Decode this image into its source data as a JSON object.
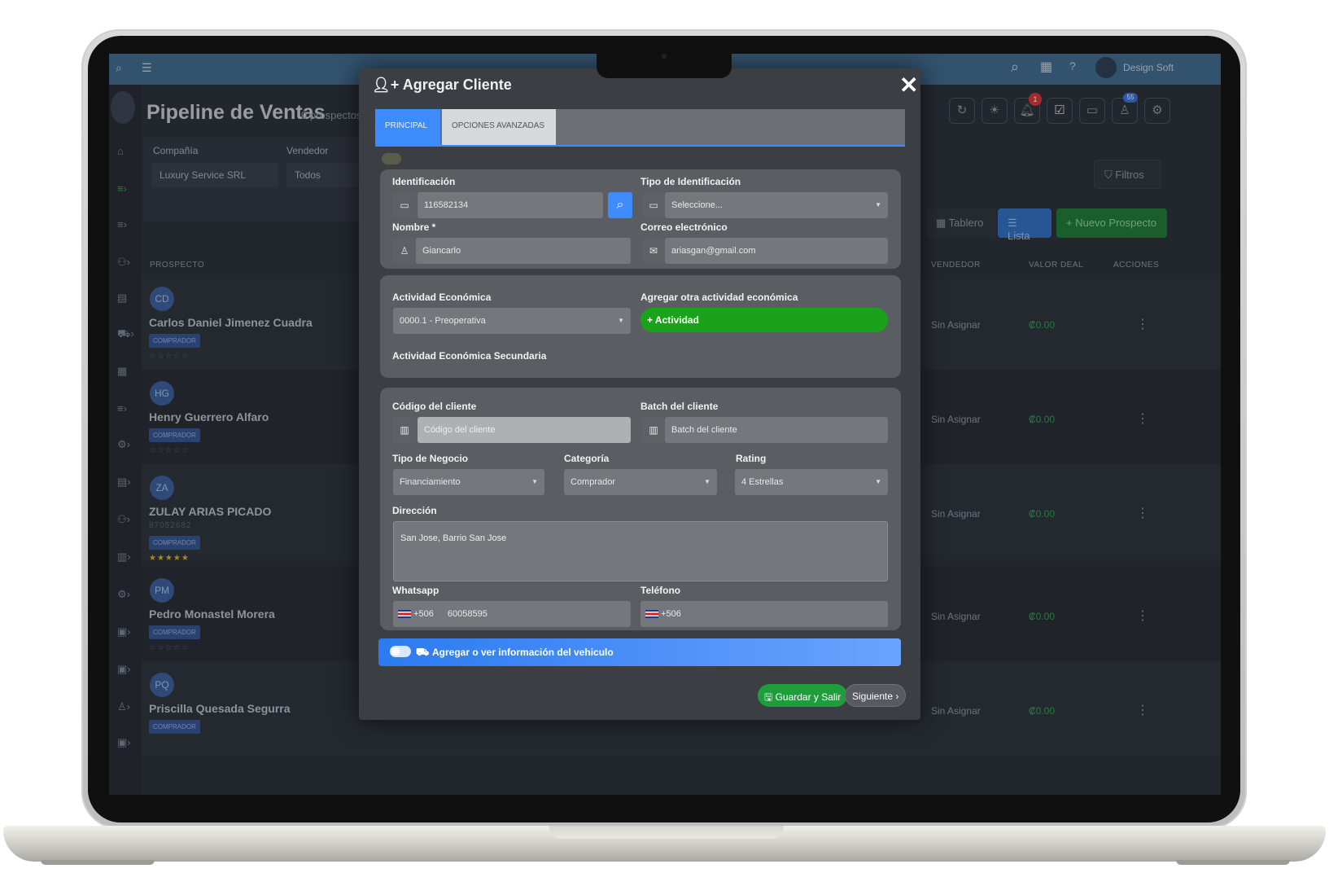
{
  "topbar": {
    "brand": "Design Soft"
  },
  "page": {
    "title": "Pipeline de Ventas",
    "subtitle": "0 prospectos ac"
  },
  "filters": {
    "company_label": "Compañía",
    "company_value": "Luxury Service SRL",
    "seller_label": "Vendedor",
    "seller_value": "Todos",
    "filters_button": "Filtros"
  },
  "view_buttons": {
    "board": "Tablero",
    "list": "Lista",
    "new": "+ Nuevo Prospecto"
  },
  "notifications": {
    "bell_count": "1",
    "users_count": "55"
  },
  "table": {
    "headers": {
      "prospect": "PROSPECTO",
      "seller": "VENDEDOR",
      "deal_value": "VALOR DEAL",
      "actions": "ACCIONES"
    },
    "rows": [
      {
        "initials": "CD",
        "name": "Carlos Daniel Jimenez Cuadra",
        "badge": "COMPRADOR",
        "phone": "",
        "stars": "☆☆☆☆☆",
        "seller": "Sin Asignar",
        "value": "₡0.00"
      },
      {
        "initials": "HG",
        "name": "Henry Guerrero Alfaro",
        "badge": "COMPRADOR",
        "phone": "",
        "stars": "☆☆☆☆☆",
        "seller": "Sin Asignar",
        "value": "₡0.00"
      },
      {
        "initials": "ZA",
        "name": "ZULAY ARIAS PICADO",
        "badge": "COMPRADOR",
        "phone": "87052682",
        "stars": "★★★★★",
        "seller": "Sin Asignar",
        "value": "₡0.00"
      },
      {
        "initials": "PM",
        "name": "Pedro Monastel Morera",
        "badge": "COMPRADOR",
        "phone": "",
        "stars": "☆☆☆☆☆",
        "seller": "Sin Asignar",
        "value": "₡0.00"
      },
      {
        "initials": "PQ",
        "name": "Priscilla Quesada Segurra",
        "badge": "COMPRADOR",
        "phone": "",
        "stars": "",
        "seller": "Sin Asignar",
        "value": "₡0.00"
      }
    ]
  },
  "modal": {
    "title": "Agregar Cliente",
    "tabs": [
      "PRINCIPAL",
      "OPCIONES AVANZADAS"
    ],
    "identification_label": "Identificación",
    "identification_value": "116582134",
    "id_type_label": "Tipo de Identificación",
    "id_type_value": "Seleccione...",
    "name_label": "Nombre *",
    "name_value": "Giancarlo",
    "email_label": "Correo electrónico",
    "email_value": "ariasgan@gmail.com",
    "activity_label": "Actividad Económica",
    "activity_value": "0000.1 - Preoperativa",
    "add_activity_label": "Agregar otra actividad económica",
    "add_activity_button": "+ Actividad",
    "secondary_activity_label": "Actividad Económica Secundaria",
    "client_code_label": "Código del cliente",
    "client_code_placeholder": "Código del cliente",
    "batch_label": "Batch del cliente",
    "batch_placeholder": "Batch del cliente",
    "business_type_label": "Tipo de Negocio",
    "business_type_value": "Financiamiento",
    "category_label": "Categoría",
    "category_value": "Comprador",
    "rating_label": "Rating",
    "rating_value": "4 Estrellas",
    "address_label": "Dirección",
    "address_value": "San Jose, Barrio San Jose",
    "whatsapp_label": "Whatsapp",
    "whatsapp_code": "+506",
    "whatsapp_value": "60058595",
    "phone_label": "Teléfono",
    "phone_code": "+506",
    "vehicle_toggle_label": "Agregar o ver información del vehiculo",
    "save_button": "Guardar y Salir",
    "next_button": "Siguiente"
  },
  "colors": {
    "accent": "#3d8bfd",
    "green": "#1aa31a",
    "modal_bg": "#3b3e43"
  }
}
